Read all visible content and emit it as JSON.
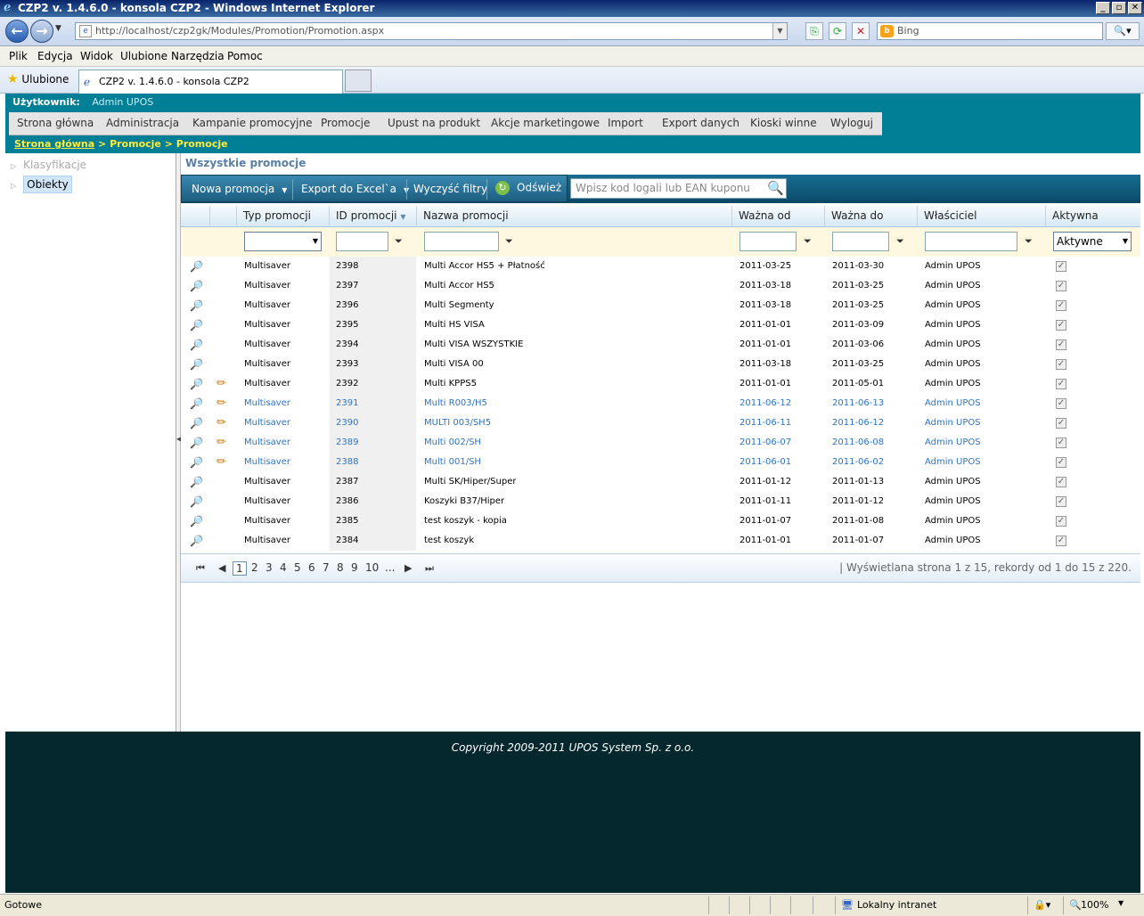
{
  "window": {
    "title": "CZP2 v. 1.4.6.0 - konsola CZP2 - Windows Internet Explorer"
  },
  "browser": {
    "url": "http://localhost/czp2gk/Modules/Promotion/Promotion.aspx",
    "search_placeholder": "Bing",
    "menu": [
      "Plik",
      "Edycja",
      "Widok",
      "Ulubione",
      "Narzędzia",
      "Pomoc"
    ],
    "favorites_label": "Ulubione",
    "tab_title": "CZP2 v. 1.4.6.0 - konsola CZP2"
  },
  "app": {
    "user_label": "Użytkownik:",
    "user_name": "Admin UPOS",
    "nav": [
      "Strona główna",
      "Administracja",
      "Kampanie promocyjne",
      "Promocje",
      "Upust na produkt",
      "Akcje marketingowe",
      "Import",
      "Export danych",
      "Kioski winne",
      "Wyloguj"
    ],
    "breadcrumb": {
      "home": "Strona główna",
      "rest": " > Promocje > Promocje"
    },
    "tree": [
      "Klasyfikacje",
      "Obiekty"
    ]
  },
  "content": {
    "title": "Wszystkie promocje",
    "toolbar": {
      "new": "Nowa promocja",
      "export": "Export do Excel`a",
      "clear": "Wyczyść filtry",
      "refresh": "Odśwież"
    },
    "search_placeholder": "Wpisz kod logali lub EAN kuponu",
    "columns": [
      "Typ promocji",
      "ID promocji",
      "Nazwa promocji",
      "Ważna od",
      "Ważna do",
      "Właściciel",
      "Aktywna"
    ],
    "active_filter": "Aktywne",
    "rows": [
      {
        "type": "Multisaver",
        "id": "2398",
        "name": "Multi Accor HS5 + Płatność",
        "from": "2011-03-25",
        "to": "2011-03-30",
        "owner": "Admin UPOS",
        "edit": false,
        "blue": false
      },
      {
        "type": "Multisaver",
        "id": "2397",
        "name": "Multi Accor HS5",
        "from": "2011-03-18",
        "to": "2011-03-25",
        "owner": "Admin UPOS",
        "edit": false,
        "blue": false
      },
      {
        "type": "Multisaver",
        "id": "2396",
        "name": "Multi Segmenty",
        "from": "2011-03-18",
        "to": "2011-03-25",
        "owner": "Admin UPOS",
        "edit": false,
        "blue": false
      },
      {
        "type": "Multisaver",
        "id": "2395",
        "name": "Multi HS VISA",
        "from": "2011-01-01",
        "to": "2011-03-09",
        "owner": "Admin UPOS",
        "edit": false,
        "blue": false
      },
      {
        "type": "Multisaver",
        "id": "2394",
        "name": "Multi VISA WSZYSTKIE",
        "from": "2011-01-01",
        "to": "2011-03-06",
        "owner": "Admin UPOS",
        "edit": false,
        "blue": false
      },
      {
        "type": "Multisaver",
        "id": "2393",
        "name": "Multi VISA 00",
        "from": "2011-03-18",
        "to": "2011-03-25",
        "owner": "Admin UPOS",
        "edit": false,
        "blue": false
      },
      {
        "type": "Multisaver",
        "id": "2392",
        "name": "Multi KPPS5",
        "from": "2011-01-01",
        "to": "2011-05-01",
        "owner": "Admin UPOS",
        "edit": true,
        "blue": false
      },
      {
        "type": "Multisaver",
        "id": "2391",
        "name": "Multi R003/H5",
        "from": "2011-06-12",
        "to": "2011-06-13",
        "owner": "Admin UPOS",
        "edit": true,
        "blue": true
      },
      {
        "type": "Multisaver",
        "id": "2390",
        "name": "MULTI 003/SH5",
        "from": "2011-06-11",
        "to": "2011-06-12",
        "owner": "Admin UPOS",
        "edit": true,
        "blue": true
      },
      {
        "type": "Multisaver",
        "id": "2389",
        "name": "Multi 002/SH",
        "from": "2011-06-07",
        "to": "2011-06-08",
        "owner": "Admin UPOS",
        "edit": true,
        "blue": true
      },
      {
        "type": "Multisaver",
        "id": "2388",
        "name": "Multi 001/SH",
        "from": "2011-06-01",
        "to": "2011-06-02",
        "owner": "Admin UPOS",
        "edit": true,
        "blue": true
      },
      {
        "type": "Multisaver",
        "id": "2387",
        "name": "Multi SK/Hiper/Super",
        "from": "2011-01-12",
        "to": "2011-01-13",
        "owner": "Admin UPOS",
        "edit": false,
        "blue": false
      },
      {
        "type": "Multisaver",
        "id": "2386",
        "name": "Koszyki B37/Hiper",
        "from": "2011-01-11",
        "to": "2011-01-12",
        "owner": "Admin UPOS",
        "edit": false,
        "blue": false
      },
      {
        "type": "Multisaver",
        "id": "2385",
        "name": "test koszyk - kopia",
        "from": "2011-01-07",
        "to": "2011-01-08",
        "owner": "Admin UPOS",
        "edit": false,
        "blue": false
      },
      {
        "type": "Multisaver",
        "id": "2384",
        "name": "test koszyk",
        "from": "2011-01-01",
        "to": "2011-01-07",
        "owner": "Admin UPOS",
        "edit": false,
        "blue": false
      }
    ],
    "pager": {
      "pages": [
        "1",
        "2",
        "3",
        "4",
        "5",
        "6",
        "7",
        "8",
        "9",
        "10",
        "..."
      ],
      "info": "| Wyświetlana strona 1 z 15, rekordy od 1 do 15 z 220."
    }
  },
  "footer": {
    "copyright": "Copyright 2009-2011 UPOS System Sp. z o.o."
  },
  "statusbar": {
    "ready": "Gotowe",
    "zone": "Lokalny intranet",
    "zoom": "100%"
  }
}
